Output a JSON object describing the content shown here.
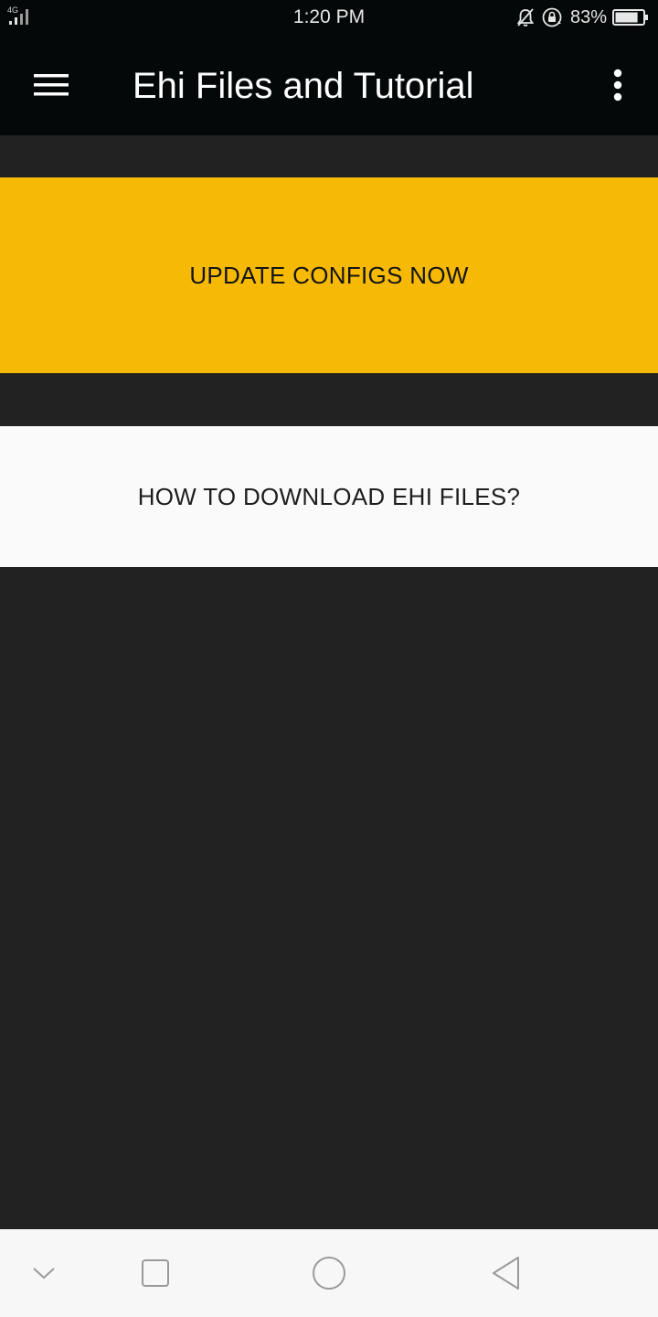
{
  "status_bar": {
    "network_type": "4G",
    "time": "1:20 PM",
    "battery_percent": "83%",
    "battery_level": 0.83,
    "icons": [
      "signal-icon",
      "mute-bell-icon",
      "rotation-lock-icon",
      "battery-icon"
    ]
  },
  "app_bar": {
    "title": "Ehi Files and Tutorial",
    "menu_icon": "hamburger-menu-icon",
    "more_icon": "more-vertical-icon"
  },
  "content": {
    "update_button_label": "UPDATE CONFIGS NOW",
    "howto_button_label": "HOW TO DOWNLOAD EHI FILES?"
  },
  "nav_bar": {
    "icons": [
      "chevron-down-icon",
      "recents-square-icon",
      "home-circle-icon",
      "back-triangle-icon"
    ]
  },
  "colors": {
    "accent": "#f6ba06",
    "background": "#222222",
    "app_bar": "#040808",
    "light_button": "#fafafa"
  }
}
